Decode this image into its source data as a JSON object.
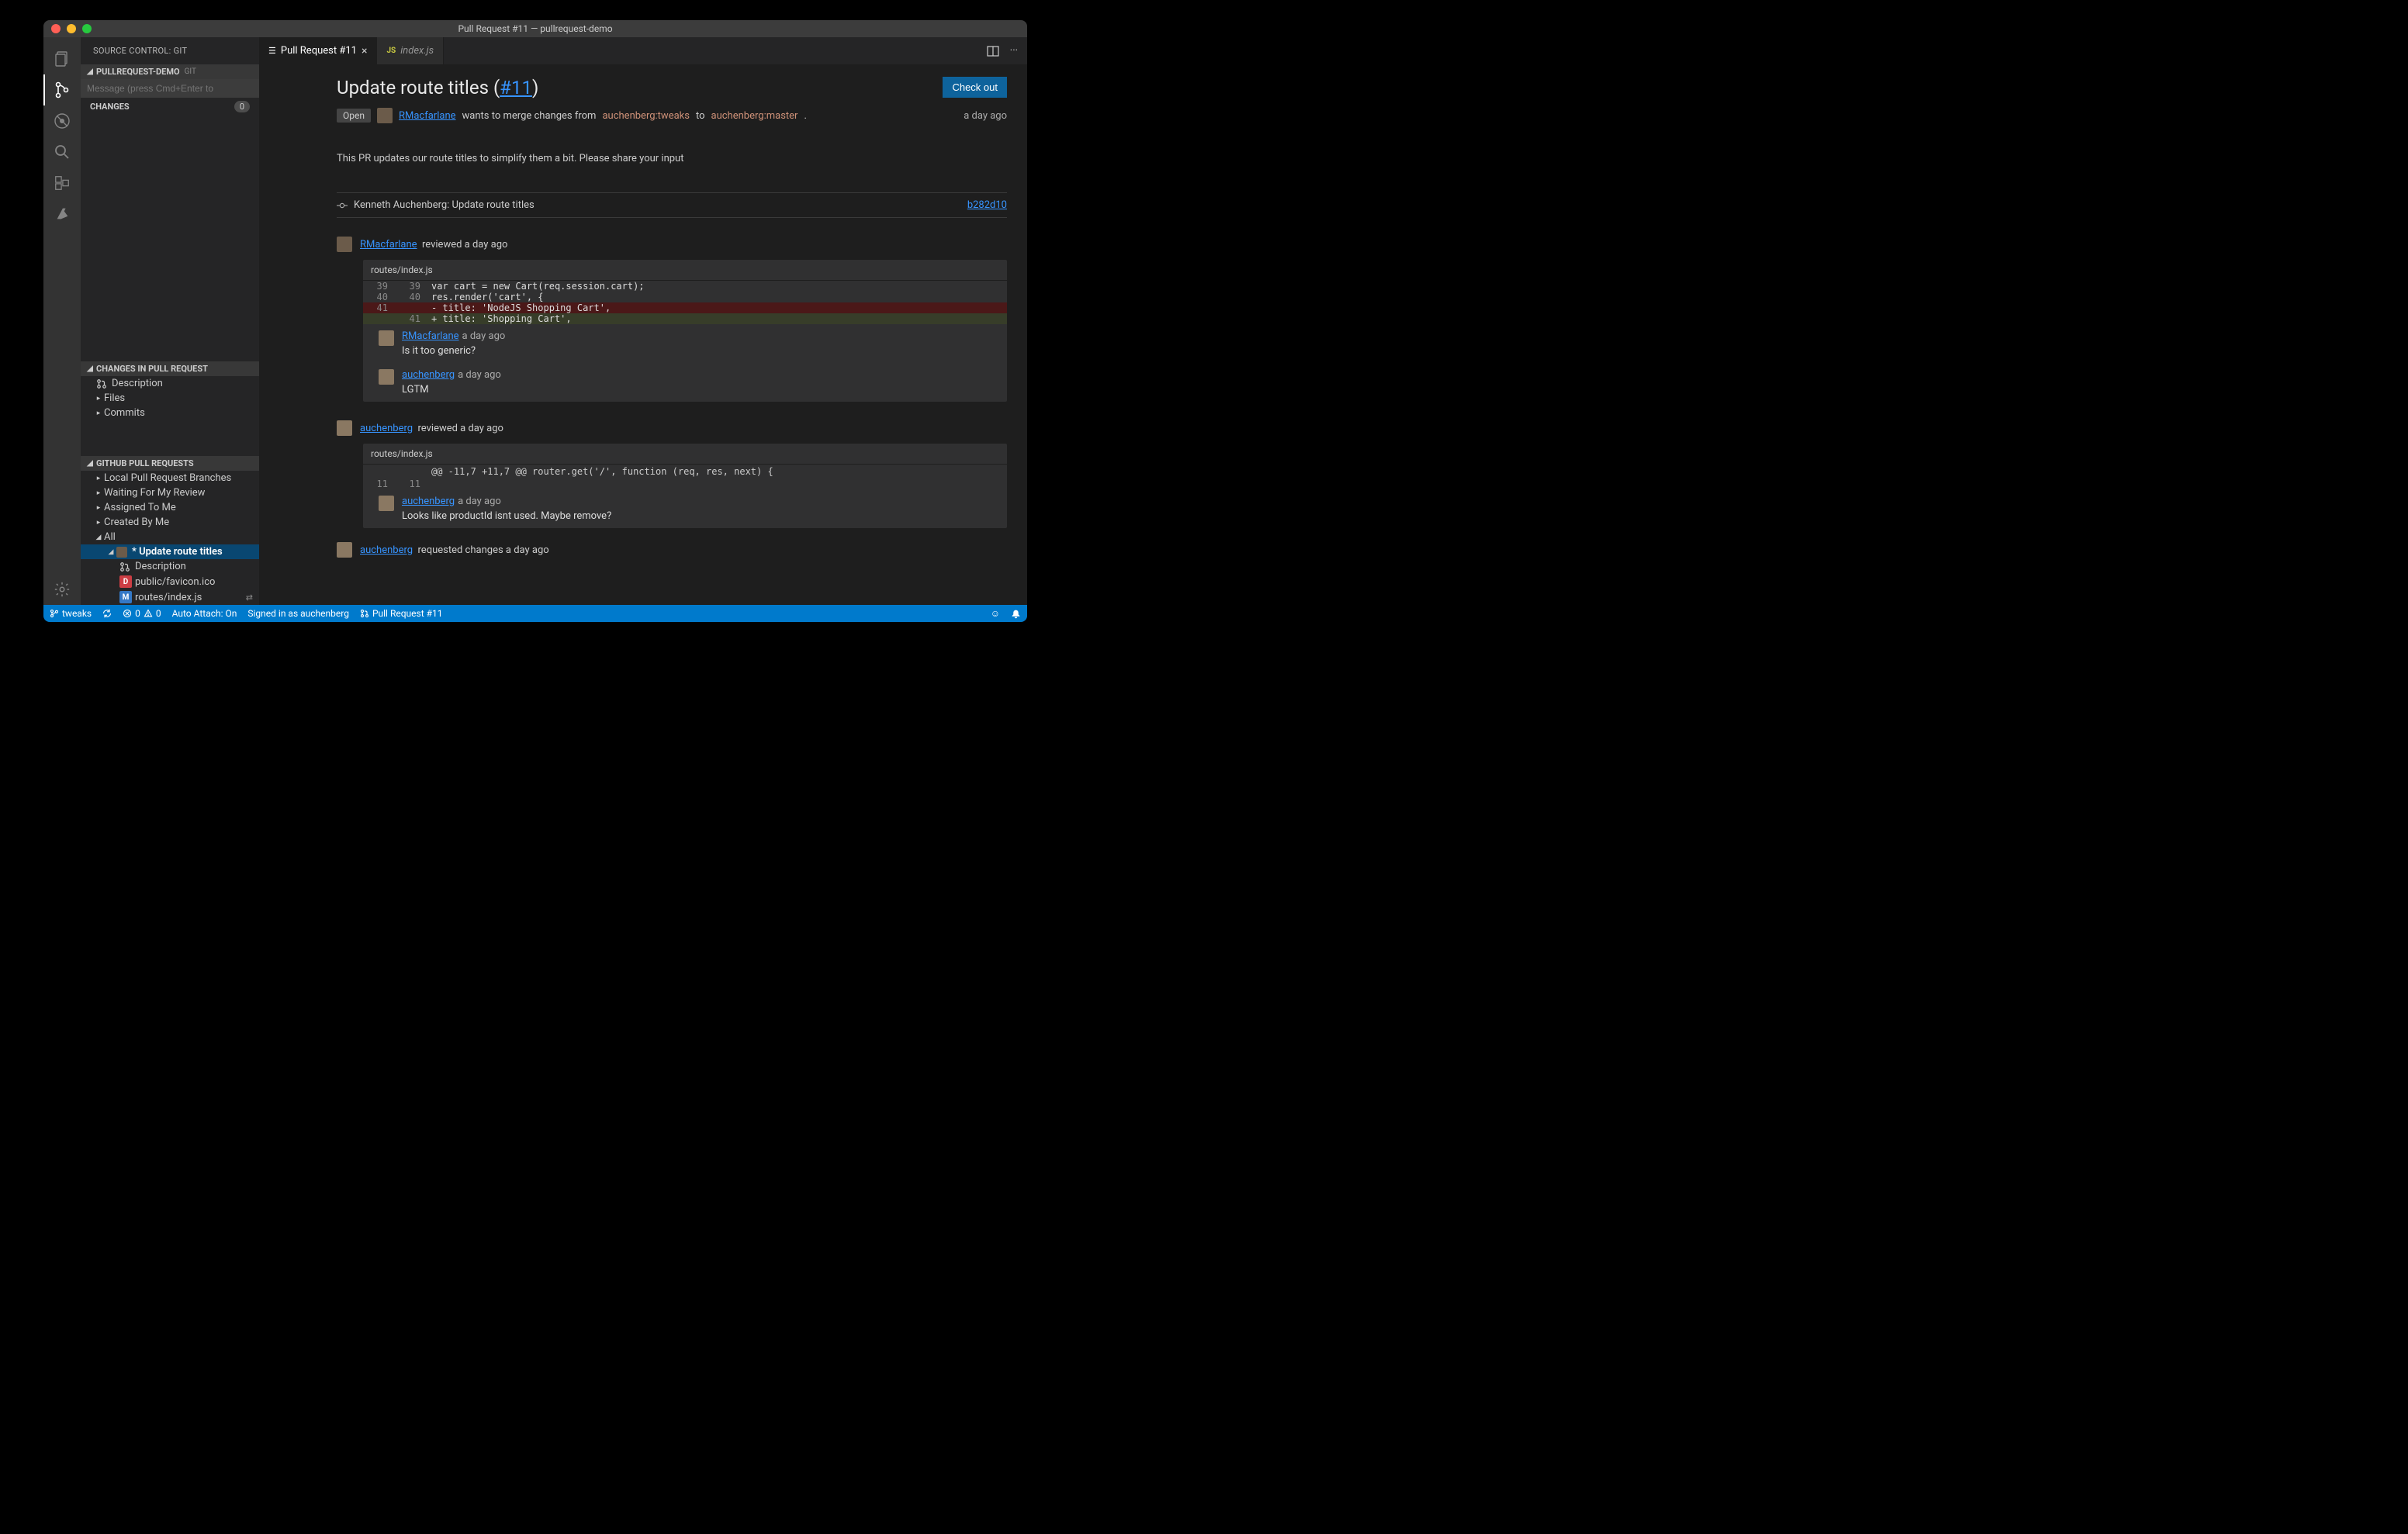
{
  "window_title": "Pull Request #11 — pullrequest-demo",
  "sidebar": {
    "title": "SOURCE CONTROL: GIT",
    "repo_section": {
      "label": "PULLREQUEST-DEMO",
      "tag": "GIT"
    },
    "commit_placeholder": "Message (press Cmd+Enter to",
    "changes_label": "CHANGES",
    "changes_count": "0",
    "pr_changes_section": "CHANGES IN PULL REQUEST",
    "pr_changes_items": [
      "Description",
      "Files",
      "Commits"
    ],
    "ghpr_section": "GITHUB PULL REQUESTS",
    "ghpr_items": [
      "Local Pull Request Branches",
      "Waiting For My Review",
      "Assigned To Me",
      "Created By Me",
      "All"
    ],
    "selected_pr": "* Update route titles",
    "selected_children": [
      {
        "icon": "pr",
        "label": "Description"
      },
      {
        "icon": "D",
        "label": "public/favicon.ico"
      },
      {
        "icon": "M",
        "label": "routes/index.js"
      }
    ]
  },
  "tabs": [
    {
      "icon": "list",
      "label": "Pull Request #11",
      "active": true,
      "closable": true
    },
    {
      "icon": "js",
      "label": "index.js",
      "active": false,
      "closable": false
    }
  ],
  "pr": {
    "title_prefix": "Update route titles (",
    "title_link": "#11",
    "title_suffix": ")",
    "checkout": "Check out",
    "status": "Open",
    "author": "RMacfarlane",
    "merge_text1": "wants to merge changes from",
    "branch_from": "auchenberg:tweaks",
    "merge_text2": "to",
    "branch_to": "auchenberg:master",
    "timeago": "a day ago",
    "description": "This PR updates our route titles to simplify them a bit. Please share your input",
    "commit_author": "Kenneth Auchenberg: Update route titles",
    "commit_sha": "b282d10"
  },
  "reviews": [
    {
      "author": "RMacfarlane",
      "action": "reviewed a day ago",
      "file": "routes/index.js",
      "diff": [
        {
          "old": "39",
          "new": "39",
          "type": "ctx",
          "code": "var cart = new Cart(req.session.cart);"
        },
        {
          "old": "40",
          "new": "40",
          "type": "ctx",
          "code": "res.render('cart', {"
        },
        {
          "old": "41",
          "new": "",
          "type": "del",
          "code": "- title: 'NodeJS Shopping Cart',"
        },
        {
          "old": "",
          "new": "41",
          "type": "add",
          "code": "+ title: 'Shopping Cart',"
        }
      ],
      "comments": [
        {
          "author": "RMacfarlane",
          "when": "a day ago",
          "text": "Is it too generic?"
        },
        {
          "author": "auchenberg",
          "when": "a day ago",
          "text": "LGTM"
        }
      ]
    },
    {
      "author": "auchenberg",
      "action": "reviewed a day ago",
      "file": "routes/index.js",
      "hunk": "@@ -11,7 +11,7 @@ router.get('/', function (req, res, next) {",
      "diff": [
        {
          "old": "11",
          "new": "11",
          "type": "ctx",
          "code": ""
        }
      ],
      "comments": [
        {
          "author": "auchenberg",
          "when": "a day ago",
          "text": "Looks like productId isnt used. Maybe remove?"
        }
      ]
    },
    {
      "author": "auchenberg",
      "action": "requested changes a day ago"
    }
  ],
  "statusbar": {
    "branch": "tweaks",
    "errors": "0",
    "warnings": "0",
    "autoattach": "Auto Attach: On",
    "signedin": "Signed in as auchenberg",
    "pr": "Pull Request #11"
  }
}
